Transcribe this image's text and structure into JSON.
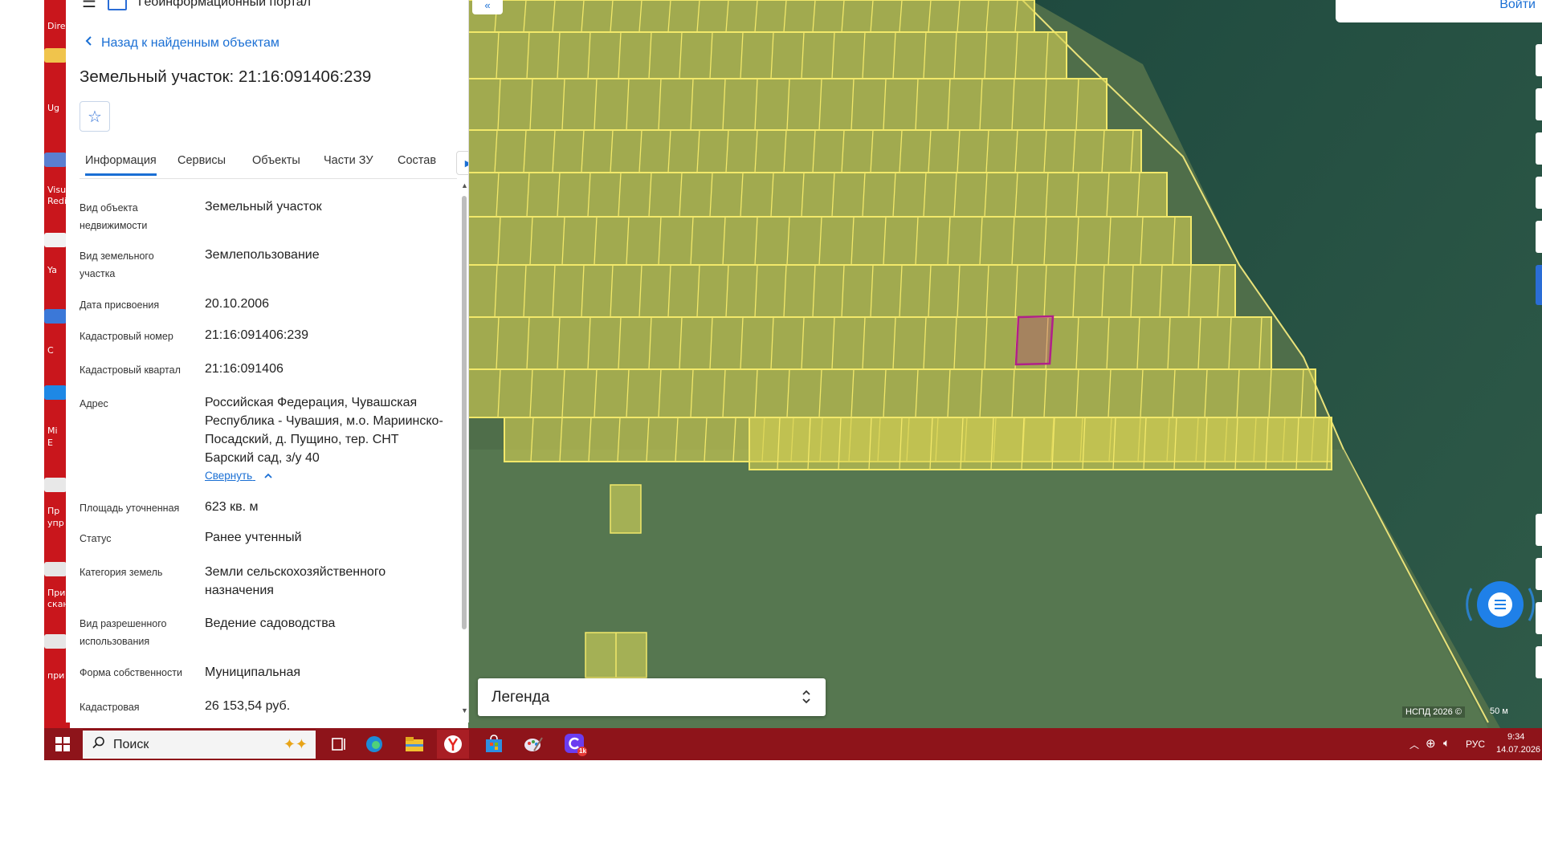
{
  "window": {
    "portal_title": "Геоинформационный портал"
  },
  "desktop": {
    "labels": [
      "Dire",
      "Ug",
      "Visu",
      "Redi",
      "Ya",
      "C",
      "Mi",
      "E",
      "Пр",
      "упр",
      "При",
      "скан",
      "при"
    ]
  },
  "panel": {
    "back_label": "Назад к найденным объектам",
    "title": "Земельный участок: 21:16:091406:239",
    "tabs": [
      "Информация",
      "Сервисы",
      "Объекты",
      "Части ЗУ",
      "Состав"
    ],
    "fields": [
      {
        "label": "Вид объекта недвижимости",
        "value": "Земельный участок"
      },
      {
        "label": "Вид земельного участка",
        "value": "Землепользование"
      },
      {
        "label": "Дата присвоения",
        "value": "20.10.2006"
      },
      {
        "label": "Кадастровый номер",
        "value": "21:16:091406:239"
      },
      {
        "label": "Кадастровый квартал",
        "value": "21:16:091406"
      },
      {
        "label": "Адрес",
        "value": "Российская Федерация, Чувашская Республика - Чувашия, м.о. Мариинско-Посадский, д. Пущино, тер. СНТ Барский сад, з/у 40"
      },
      {
        "label": "Площадь уточненная",
        "value": "623 кв. м"
      },
      {
        "label": "Статус",
        "value": "Ранее учтенный"
      },
      {
        "label": "Категория земель",
        "value": "Земли сельскохозяйственного назначения"
      },
      {
        "label": "Вид разрешенного использования",
        "value": "Ведение садоводства"
      },
      {
        "label": "Форма собственности",
        "value": "Муниципальная"
      },
      {
        "label": "Кадастровая",
        "value": "26 153,54 руб."
      }
    ],
    "collapse_label": "Свернуть"
  },
  "map": {
    "legend_label": "Легенда",
    "login_label": "Войти",
    "attribution": "НСПД 2026 ©",
    "scale_label": "50 м"
  },
  "taskbar": {
    "search_placeholder": "Поиск",
    "lang": "РУС",
    "time": "9:34",
    "date": "14.07.2026",
    "badge": "1k"
  },
  "colors": {
    "accent": "#1a6fd4",
    "parcel_fill": "#d4cf52",
    "parcel_stroke": "#f2e86a",
    "selected_stroke": "#b0208a",
    "taskbar": "#8e141a",
    "desktop_bg": "#c9161c"
  }
}
